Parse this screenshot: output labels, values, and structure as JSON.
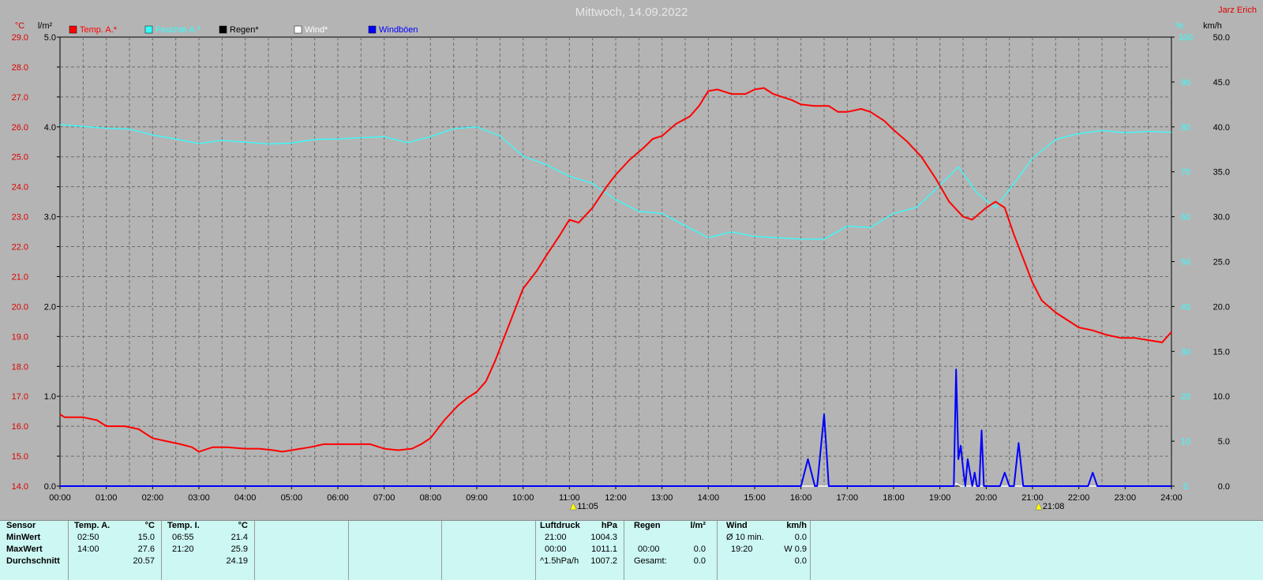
{
  "title": "Mittwoch, 14.09.2022",
  "author": "Jarz Erich",
  "legend": [
    {
      "label": "Temp. A.*",
      "color": "#ff0000"
    },
    {
      "label": "Feuchte A.*",
      "color": "#33ffff"
    },
    {
      "label": "Regen*",
      "color": "#000000"
    },
    {
      "label": "Wind*",
      "color": "#ffffff"
    },
    {
      "label": "Windböen",
      "color": "#0000ff"
    }
  ],
  "axis_units": {
    "temp": "°C",
    "rain": "l/m²",
    "humidity": "%",
    "wind": "km/h"
  },
  "markers": [
    {
      "time": "11:05",
      "label": "11:05"
    },
    {
      "time": "21:08",
      "label": "21:08"
    }
  ],
  "chart_data": {
    "type": "line",
    "x_labels": [
      "00:00",
      "01:00",
      "02:00",
      "03:00",
      "04:00",
      "05:00",
      "06:00",
      "07:00",
      "08:00",
      "09:00",
      "10:00",
      "11:00",
      "12:00",
      "13:00",
      "14:00",
      "15:00",
      "16:00",
      "17:00",
      "18:00",
      "19:00",
      "20:00",
      "21:00",
      "22:00",
      "23:00",
      "24:00"
    ],
    "xlim": [
      0,
      24
    ],
    "axes": {
      "temp": {
        "min": 14.0,
        "max": 29.0,
        "ticks": [
          "29.0",
          "28.0",
          "27.0",
          "26.0",
          "25.0",
          "24.0",
          "23.0",
          "22.0",
          "21.0",
          "20.0",
          "19.0",
          "18.0",
          "17.0",
          "16.0",
          "15.0",
          "14.0"
        ]
      },
      "rain": {
        "min": 0.0,
        "max": 5.0,
        "ticks": [
          "5.0",
          "4.0",
          "3.0",
          "2.0",
          "1.0",
          "0.0"
        ]
      },
      "humidity": {
        "min": 0,
        "max": 100,
        "ticks": [
          "100",
          "90",
          "80",
          "70",
          "60",
          "50",
          "40",
          "30",
          "20",
          "10",
          "0"
        ]
      },
      "wind": {
        "min": 0.0,
        "max": 50.0,
        "ticks": [
          "50.0",
          "45.0",
          "40.0",
          "35.0",
          "30.0",
          "25.0",
          "20.0",
          "15.0",
          "10.0",
          "5.0",
          "0.0"
        ]
      }
    },
    "series": [
      {
        "name": "Temp. A.*",
        "axis": "temp",
        "color": "#ff0000",
        "x": [
          0,
          0.1,
          0.5,
          0.8,
          1.0,
          1.4,
          1.7,
          2.0,
          2.3,
          2.6,
          2.85,
          3.0,
          3.3,
          3.6,
          4.0,
          4.3,
          4.6,
          4.8,
          5.0,
          5.4,
          5.7,
          6.0,
          6.3,
          6.7,
          7.0,
          7.3,
          7.6,
          7.8,
          8.0,
          8.3,
          8.6,
          8.8,
          9.0,
          9.2,
          9.4,
          9.6,
          9.8,
          10.0,
          10.3,
          10.5,
          10.8,
          11.0,
          11.2,
          11.5,
          11.8,
          12.0,
          12.3,
          12.6,
          12.8,
          13.0,
          13.3,
          13.6,
          13.8,
          14.0,
          14.2,
          14.5,
          14.8,
          15.0,
          15.2,
          15.4,
          15.6,
          15.8,
          16.0,
          16.3,
          16.6,
          16.8,
          17.0,
          17.3,
          17.5,
          17.8,
          18.0,
          18.3,
          18.6,
          18.9,
          19.2,
          19.5,
          19.7,
          20.0,
          20.2,
          20.4,
          20.6,
          20.8,
          21.0,
          21.2,
          21.5,
          21.8,
          22.0,
          22.3,
          22.6,
          22.9,
          23.2,
          23.4,
          23.6,
          23.8,
          24.0
        ],
        "y": [
          16.4,
          16.3,
          16.3,
          16.2,
          16.0,
          16.0,
          15.9,
          15.6,
          15.5,
          15.4,
          15.3,
          15.15,
          15.3,
          15.3,
          15.25,
          15.25,
          15.2,
          15.15,
          15.2,
          15.3,
          15.4,
          15.4,
          15.4,
          15.4,
          15.25,
          15.2,
          15.25,
          15.4,
          15.6,
          16.2,
          16.7,
          16.95,
          17.15,
          17.5,
          18.2,
          19.0,
          19.8,
          20.6,
          21.2,
          21.7,
          22.4,
          22.9,
          22.8,
          23.3,
          24.0,
          24.4,
          24.9,
          25.3,
          25.6,
          25.7,
          26.1,
          26.35,
          26.7,
          27.2,
          27.25,
          27.1,
          27.1,
          27.25,
          27.3,
          27.1,
          27.0,
          26.9,
          26.75,
          26.7,
          26.7,
          26.5,
          26.5,
          26.6,
          26.5,
          26.2,
          25.9,
          25.5,
          25.0,
          24.3,
          23.5,
          23.0,
          22.9,
          23.3,
          23.5,
          23.3,
          22.4,
          21.6,
          20.8,
          20.2,
          19.8,
          19.5,
          19.3,
          19.2,
          19.05,
          18.95,
          18.95,
          18.9,
          18.85,
          18.8,
          19.15
        ]
      },
      {
        "name": "Feuchte A.*",
        "axis": "humidity",
        "color": "#33ffff",
        "x": [
          0,
          0.5,
          1.0,
          1.5,
          2.0,
          2.5,
          3.0,
          3.5,
          4.0,
          4.5,
          5.0,
          5.5,
          6.0,
          6.5,
          7.0,
          7.5,
          8.0,
          8.5,
          9.0,
          9.5,
          10.0,
          10.5,
          11.0,
          11.5,
          12.0,
          12.5,
          13.0,
          13.5,
          14.0,
          14.5,
          15.0,
          15.5,
          16.0,
          16.5,
          17.0,
          17.5,
          18.0,
          18.5,
          19.0,
          19.4,
          19.8,
          20.2,
          20.6,
          21.0,
          21.5,
          22.0,
          22.5,
          23.0,
          23.5,
          24.0
        ],
        "y": [
          80.5,
          80.1,
          79.7,
          79.5,
          78.2,
          77.3,
          76.3,
          77.0,
          76.6,
          76.2,
          76.4,
          77.2,
          77.3,
          77.6,
          77.8,
          76.5,
          77.8,
          79.6,
          80.0,
          78.0,
          73.5,
          71.6,
          69.0,
          67.4,
          63.8,
          61.2,
          60.7,
          58.0,
          55.3,
          56.6,
          55.6,
          55.3,
          55.0,
          55.0,
          57.9,
          57.6,
          60.7,
          62.1,
          67.0,
          71.1,
          65.3,
          62.0,
          67.4,
          73.0,
          77.2,
          78.5,
          79.2,
          78.7,
          79.0,
          78.8
        ]
      },
      {
        "name": "Windböen",
        "axis": "wind",
        "color": "#0000ff",
        "x": [
          0,
          16.0,
          16.15,
          16.3,
          16.35,
          16.5,
          16.6,
          16.7,
          19.3,
          19.35,
          19.4,
          19.45,
          19.5,
          19.55,
          19.6,
          19.65,
          19.7,
          19.75,
          19.8,
          19.85,
          19.9,
          19.95,
          20.0,
          20.05,
          20.1,
          20.3,
          20.4,
          20.5,
          20.6,
          20.7,
          20.8,
          22.2,
          22.3,
          22.4,
          24.0
        ],
        "y": [
          0,
          0,
          3.0,
          0,
          0,
          8.0,
          0,
          0,
          0,
          13.0,
          3.0,
          4.5,
          2.0,
          0,
          3.0,
          1.5,
          0,
          1.5,
          0,
          0,
          6.2,
          0,
          0,
          0,
          0,
          0,
          1.5,
          0,
          0,
          4.8,
          0,
          0,
          1.5,
          0,
          0
        ]
      },
      {
        "name": "Wind*",
        "axis": "wind",
        "color": "#ffffff",
        "x": [
          0,
          19.3,
          19.35,
          19.45,
          24.0
        ],
        "y": [
          0,
          0,
          0.3,
          0,
          0
        ]
      },
      {
        "name": "Regen*",
        "axis": "rain",
        "color": "#000000",
        "x": [
          0,
          24
        ],
        "y": [
          0,
          0
        ]
      }
    ]
  },
  "stats": {
    "sensor": {
      "title": "Sensor",
      "rows": [
        "MinWert",
        "MaxWert",
        "Durchschnitt"
      ]
    },
    "temp_a": {
      "title": "Temp. A.",
      "unit": "°C",
      "min_time": "02:50",
      "min_val": "15.0",
      "max_time": "14:00",
      "max_val": "27.6",
      "avg": "20.57"
    },
    "temp_i": {
      "title": "Temp. I.",
      "unit": "°C",
      "min_time": "06:55",
      "min_val": "21.4",
      "max_time": "21:20",
      "max_val": "25.9",
      "avg": "24.19"
    },
    "luftdruck": {
      "title": "Luftdruck",
      "unit": "hPa",
      "r1_time": "21:00",
      "r1_val": "1004.3",
      "r2_time": "00:00",
      "r2_val": "1011.1",
      "r3_time": "^1.5hPa/h",
      "r3_val": "1007.2"
    },
    "regen": {
      "title": "Regen",
      "unit": "l/m²",
      "r2_time": "00:00",
      "r2_val": "0.0",
      "r3_label": "Gesamt:",
      "r3_val": "0.0"
    },
    "wind": {
      "title": "Wind",
      "unit": "km/h",
      "r1_label": "Ø 10 min.",
      "r1_val": "0.0",
      "r2_time": "19:20",
      "r2_val": "W 0.9",
      "r3_val": "0.0"
    }
  }
}
